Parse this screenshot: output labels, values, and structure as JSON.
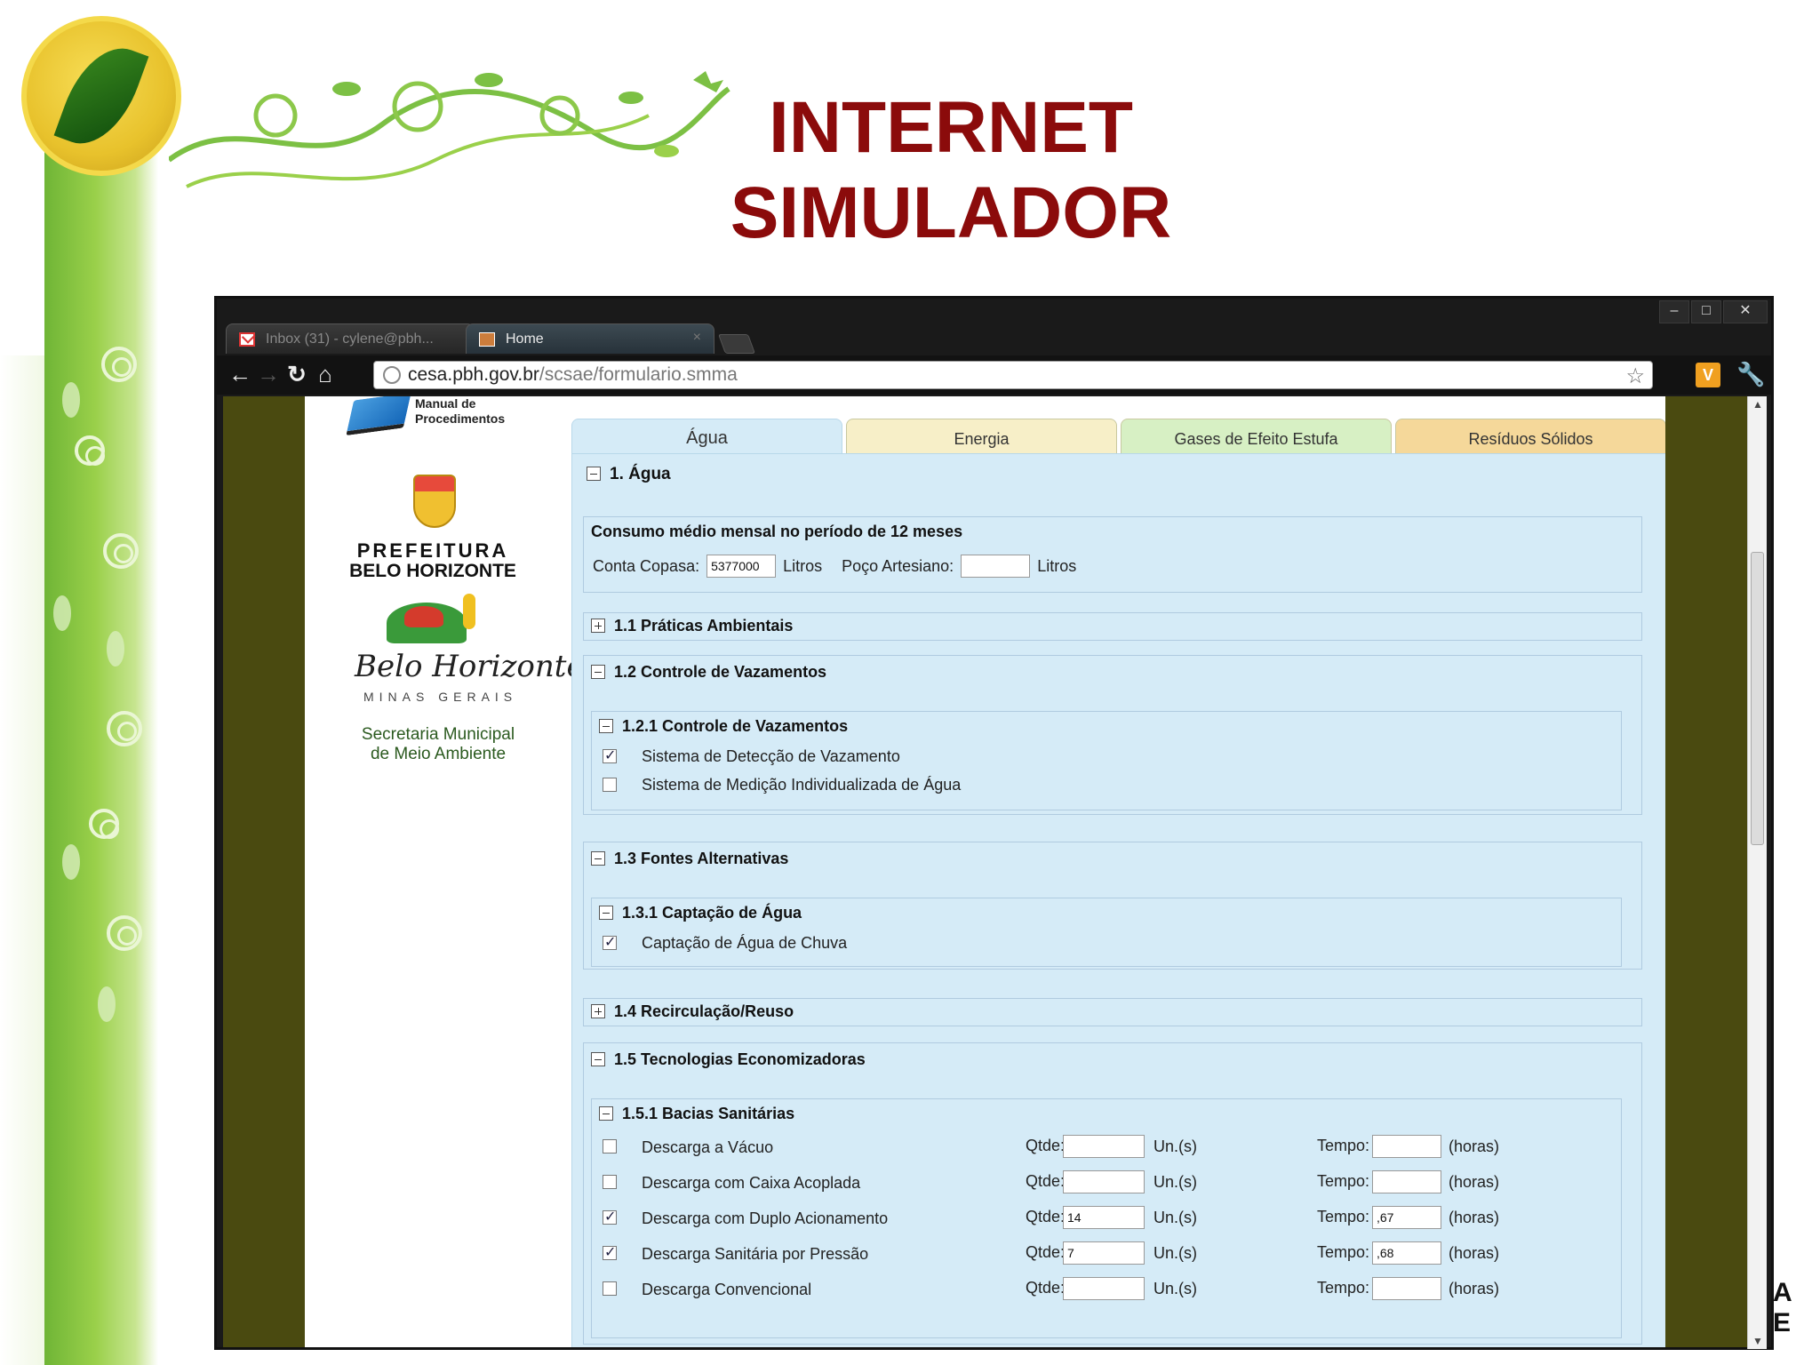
{
  "slide": {
    "title_line1": "INTERNET",
    "title_line2": "SIMULADOR",
    "corner_letters": [
      "A",
      "E"
    ]
  },
  "browser": {
    "tabs": [
      {
        "label": "Inbox (31) - cylene@pbh...",
        "active": false,
        "icon": "gmail-icon"
      },
      {
        "label": "Home",
        "active": true,
        "icon": "page-icon"
      }
    ],
    "url_host": "cesa.pbh.gov.br",
    "url_path": "/scsae/formulario.smma",
    "window_controls": [
      "minimize",
      "maximize",
      "close"
    ]
  },
  "sidebar": {
    "manual": "Manual de Procedimentos",
    "prefeitura_line1": "PREFEITURA",
    "prefeitura_line2": "BELO HORIZONTE",
    "city_script": "Belo Horizonte",
    "state": "MINAS GERAIS",
    "secretaria_line1": "Secretaria Municipal",
    "secretaria_line2": "de Meio Ambiente"
  },
  "form": {
    "tabs": [
      "Água",
      "Energia",
      "Gases de Efeito Estufa",
      "Resíduos Sólidos"
    ],
    "active_tab": "Água",
    "section_main": "1. Água",
    "consumo": {
      "title": "Consumo médio mensal no período de 12 meses",
      "copasa_label": "Conta Copasa:",
      "copasa_value": "5377000",
      "copasa_unit": "Litros",
      "poco_label": "Poço Artesiano:",
      "poco_value": "",
      "poco_unit": "Litros"
    },
    "s11": "1.1 Práticas Ambientais",
    "s12": "1.2 Controle de Vazamentos",
    "s121": "1.2.1 Controle de Vazamentos",
    "s121_options": [
      {
        "label": "Sistema de Detecção de Vazamento",
        "checked": true
      },
      {
        "label": "Sistema de Medição Individualizada de Água",
        "checked": false
      }
    ],
    "s13": "1.3 Fontes Alternativas",
    "s131": "1.3.1 Captação de Água",
    "s131_options": [
      {
        "label": "Captação de Água de Chuva",
        "checked": true
      }
    ],
    "s14": "1.4 Recirculação/Reuso",
    "s15": "1.5 Tecnologias Economizadoras",
    "s151": "1.5.1 Bacias Sanitárias",
    "qtde_label": "Qtde:",
    "un_label": "Un.(s)",
    "tempo_label": "Tempo:",
    "horas_label": "(horas)",
    "bacias": [
      {
        "label": "Descarga a Vácuo",
        "checked": false,
        "qtde": "",
        "tempo": ""
      },
      {
        "label": "Descarga com Caixa Acoplada",
        "checked": false,
        "qtde": "",
        "tempo": ""
      },
      {
        "label": "Descarga com Duplo Acionamento",
        "checked": true,
        "qtde": "14",
        "tempo": ",67"
      },
      {
        "label": "Descarga Sanitária por Pressão",
        "checked": true,
        "qtde": "7",
        "tempo": ",68"
      },
      {
        "label": "Descarga Convencional",
        "checked": false,
        "qtde": "",
        "tempo": ""
      }
    ]
  }
}
